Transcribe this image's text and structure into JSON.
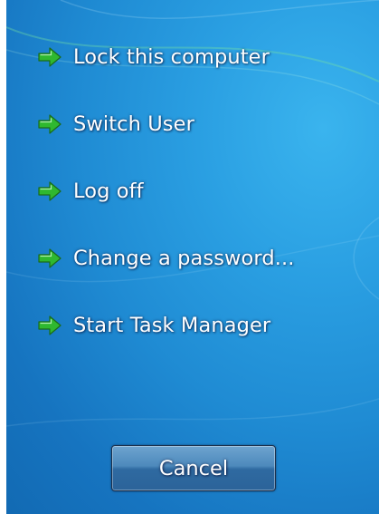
{
  "options": [
    {
      "label": "Lock this computer",
      "icon": "green-arrow-icon"
    },
    {
      "label": "Switch User",
      "icon": "green-arrow-icon"
    },
    {
      "label": "Log off",
      "icon": "green-arrow-icon"
    },
    {
      "label": "Change a password...",
      "icon": "green-arrow-icon"
    },
    {
      "label": "Start Task Manager",
      "icon": "green-arrow-icon"
    }
  ],
  "cancel_label": "Cancel",
  "colors": {
    "background": "#1f8bd3",
    "arrow": "#2fb82f",
    "text": "#ffffff",
    "button": "#3f7cb3"
  }
}
